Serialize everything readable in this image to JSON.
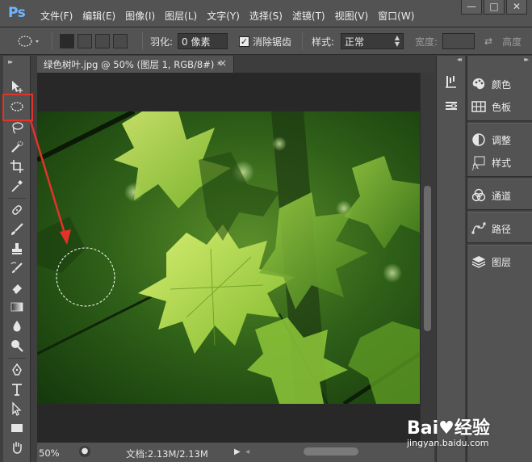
{
  "app": {
    "logo": "Ps"
  },
  "menu": [
    "文件(F)",
    "编辑(E)",
    "图像(I)",
    "图层(L)",
    "文字(Y)",
    "选择(S)",
    "滤镜(T)",
    "视图(V)",
    "窗口(W)"
  ],
  "window_controls": {
    "minimize": "—",
    "maximize": "□",
    "close": "✕"
  },
  "options": {
    "feather_label": "羽化:",
    "feather_value": "0 像素",
    "antialias_label": "消除锯齿",
    "antialias_checked": true,
    "style_label": "样式:",
    "style_value": "正常",
    "width_label": "宽度:",
    "height_label": "高度"
  },
  "document": {
    "tab_title": "绿色树叶.jpg @ 50% (图层 1, RGB/8#) *",
    "close_glyph": "×"
  },
  "status": {
    "zoom": "50%",
    "doc_info": "文档:2.13M/2.13M"
  },
  "panels": [
    {
      "label": "颜色",
      "icon": "palette-icon"
    },
    {
      "label": "色板",
      "icon": "swatches-icon"
    },
    {
      "label": "调整",
      "icon": "adjustments-icon"
    },
    {
      "label": "样式",
      "icon": "fx-styles-icon"
    },
    {
      "label": "通道",
      "icon": "channels-icon"
    },
    {
      "label": "路径",
      "icon": "paths-icon"
    },
    {
      "label": "图层",
      "icon": "layers-icon"
    }
  ],
  "watermark": {
    "logo": "Bai♥经验",
    "url": "jingyan.baidu.com"
  },
  "colors": {
    "annotation": "#e2332a",
    "ps_blue": "#6fb6ff",
    "ui_dark": "#535353"
  }
}
